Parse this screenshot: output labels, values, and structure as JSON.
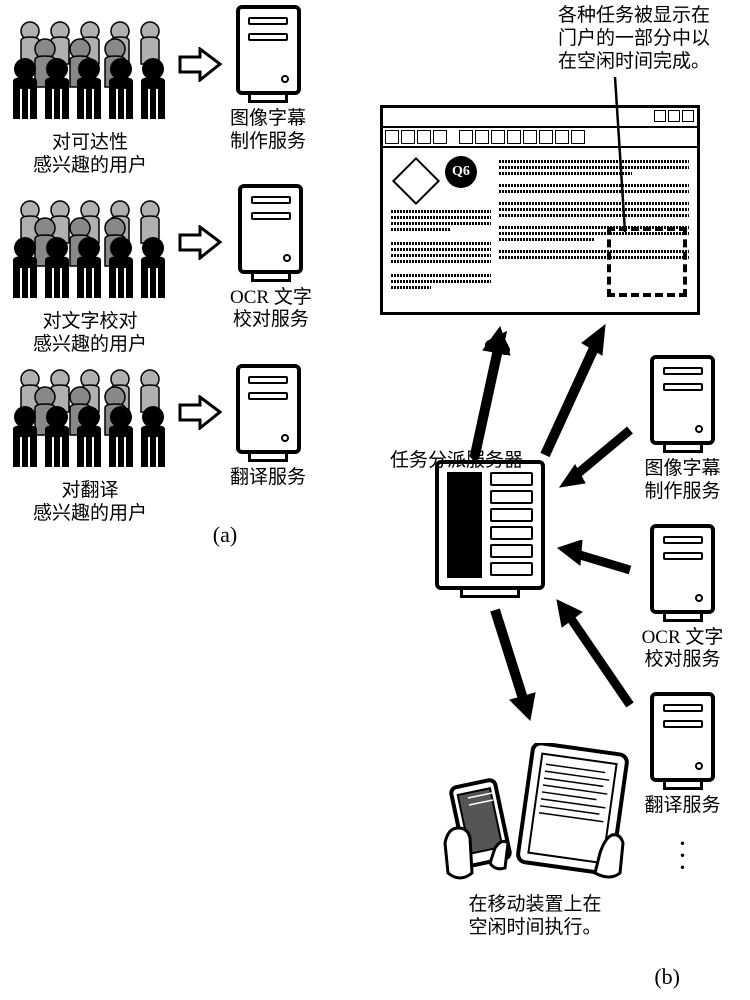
{
  "left": {
    "rows": [
      {
        "user_label_l1": "对可达性",
        "user_label_l2": "感兴趣的用户",
        "service_l1": "图像字幕",
        "service_l2": "制作服务"
      },
      {
        "user_label_l1": "对文字校对",
        "user_label_l2": "感兴趣的用户",
        "service_l1": "OCR 文字",
        "service_l2": "校对服务"
      },
      {
        "user_label_l1": "对翻译",
        "user_label_l2": "感兴趣的用户",
        "service_l1": "翻译服务",
        "service_l2": ""
      }
    ],
    "part_label": "(a)"
  },
  "right": {
    "portal_note_l1": "各种任务被显示在",
    "portal_note_l2": "门户的一部分中以",
    "portal_note_l3": "在空闲时间完成。",
    "q6_label": "Q6",
    "central_server_label": "任务分派服务器",
    "services": [
      {
        "l1": "图像字幕",
        "l2": "制作服务"
      },
      {
        "l1": "OCR 文字",
        "l2": "校对服务"
      },
      {
        "l1": "翻译服务",
        "l2": ""
      }
    ],
    "mobile_label_l1": "在移动装置上在",
    "mobile_label_l2": "空闲时间执行。",
    "part_label": "(b)"
  }
}
